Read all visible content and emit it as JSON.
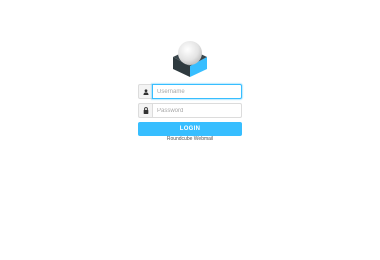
{
  "login": {
    "username_placeholder": "Username",
    "password_placeholder": "Password",
    "button_label": "LOGIN"
  },
  "footer": {
    "product_name": "Roundcube Webmail"
  },
  "icons": {
    "logo": "roundcube-logo",
    "user": "user-icon",
    "lock": "lock-icon"
  },
  "colors": {
    "accent": "#37beff",
    "logo_dark": "#2f3a3f",
    "logo_blue": "#37beff"
  }
}
